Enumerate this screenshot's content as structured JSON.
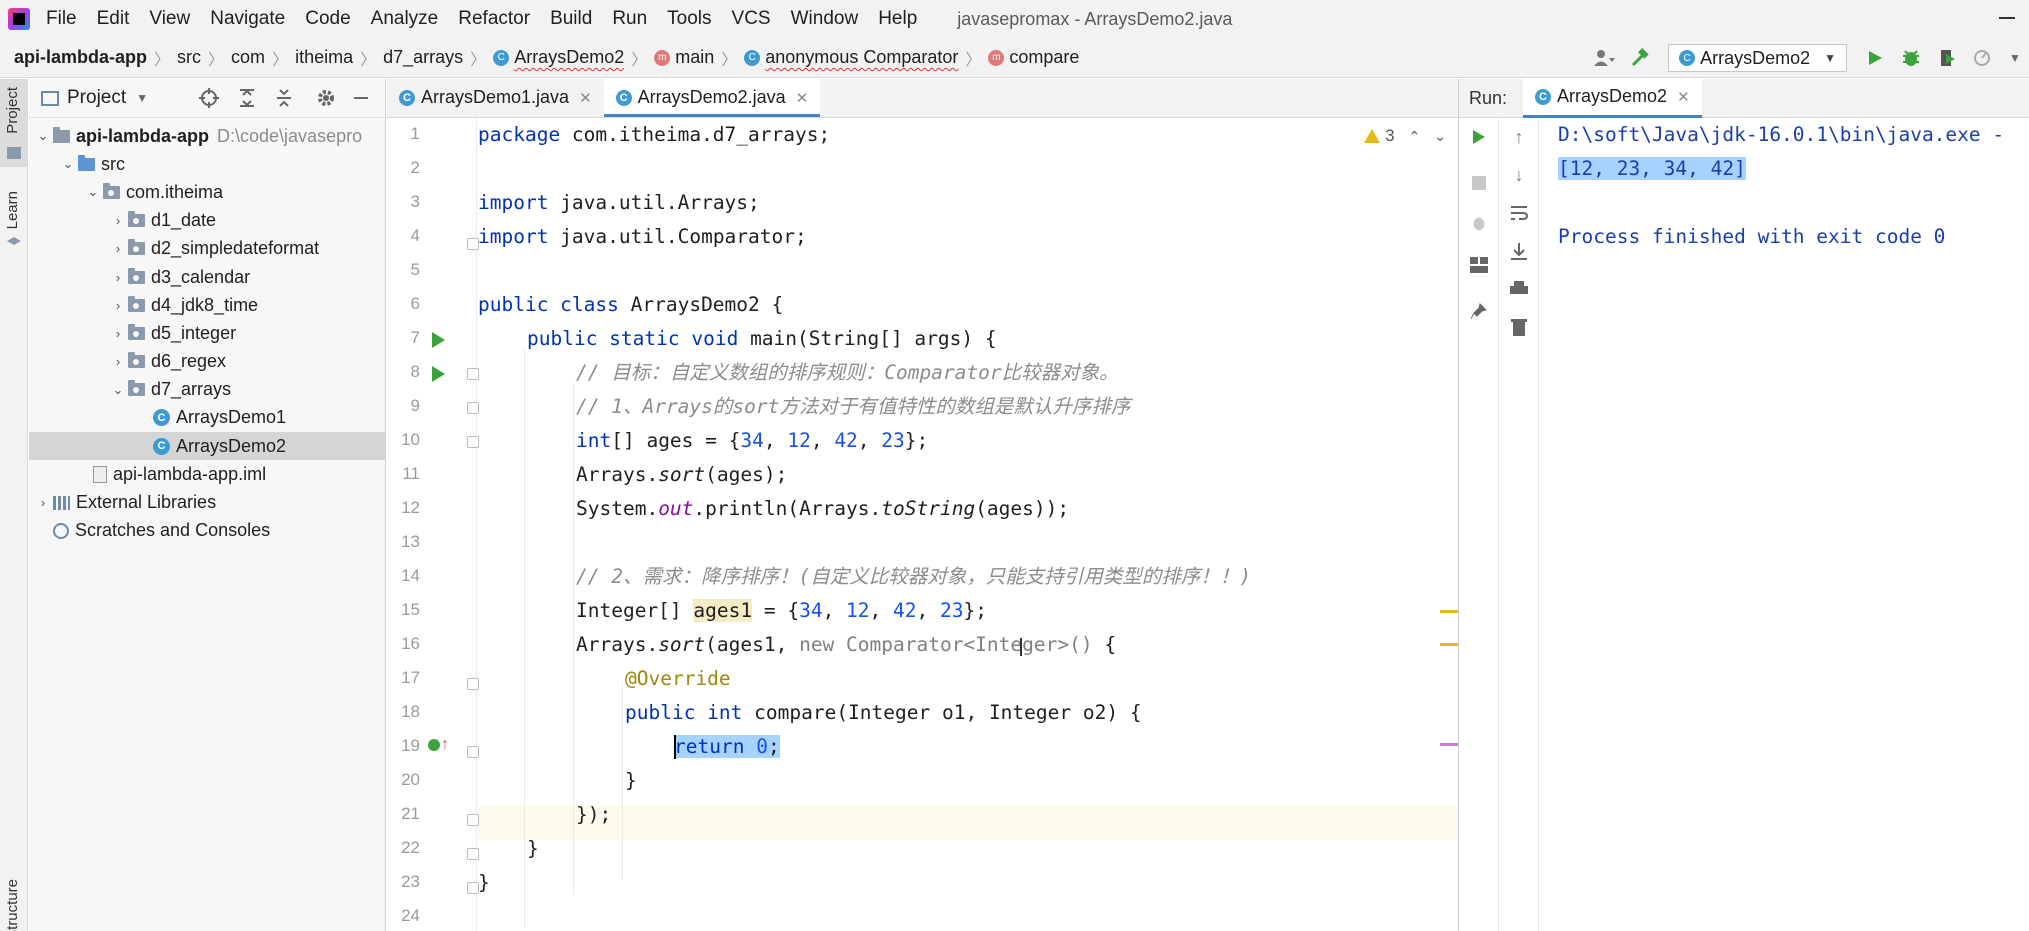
{
  "menubar": {
    "items": [
      "File",
      "Edit",
      "View",
      "Navigate",
      "Code",
      "Analyze",
      "Refactor",
      "Build",
      "Run",
      "Tools",
      "VCS",
      "Window",
      "Help"
    ],
    "window_title": "javasepromax - ArraysDemo2.java"
  },
  "breadcrumb": {
    "project": "api-lambda-app",
    "src": "src",
    "com": "com",
    "itheima": "itheima",
    "package": "d7_arrays",
    "class": "ArraysDemo2",
    "method": "main",
    "anonymous": "anonymous Comparator",
    "compare": "compare"
  },
  "toolbar": {
    "run_config": "ArraysDemo2"
  },
  "left_stripe": {
    "project": "Project",
    "learn": "Learn",
    "structure": "Structure"
  },
  "project_panel": {
    "title": "Project",
    "tree": {
      "root": "api-lambda-app",
      "root_path": "D:\\code\\javasepro",
      "src": "src",
      "package_root": "com.itheima",
      "packages": [
        "d1_date",
        "d2_simpledateformat",
        "d3_calendar",
        "d4_jdk8_time",
        "d5_integer",
        "d6_regex",
        "d7_arrays"
      ],
      "classes": [
        "ArraysDemo1",
        "ArraysDemo2"
      ],
      "iml": "api-lambda-app.iml",
      "external": "External Libraries",
      "scratches": "Scratches and Consoles"
    }
  },
  "editor": {
    "tabs": [
      "ArraysDemo1.java",
      "ArraysDemo2.java"
    ],
    "active_tab": "ArraysDemo2.java",
    "warning_count": "3",
    "line_numbers": [
      "1",
      "2",
      "3",
      "4",
      "5",
      "6",
      "7",
      "8",
      "9",
      "10",
      "11",
      "12",
      "13",
      "14",
      "15",
      "16",
      "17",
      "18",
      "19",
      "20",
      "21",
      "22",
      "23",
      "24"
    ],
    "code": {
      "l1_kw": "package",
      "l1_rest": " com.itheima.d7_arrays;",
      "l3_kw": "import",
      "l3_rest": " java.util.Arrays;",
      "l4_kw": "import",
      "l4_rest": " java.util.Comparator;",
      "l6_kw": "public class",
      "l6_rest": " ArraysDemo2 {",
      "l7_kw": "public static void",
      "l7_rest": " main(String[] args) {",
      "l8": "// 目标：自定义数组的排序规则：Comparator比较器对象。",
      "l9": "// 1、Arrays的sort方法对于有值特性的数组是默认升序排序",
      "l10_kw": "int",
      "l10_a": "[] ages = {",
      "l10_n1": "34",
      "l10_n2": "12",
      "l10_n3": "42",
      "l10_n4": "23",
      "l10_end": "};",
      "l11_a": "Arrays.",
      "l11_m": "sort",
      "l11_b": "(ages);",
      "l12_a": "System.",
      "l12_s": "out",
      "l12_b": ".println(Arrays.",
      "l12_m": "toString",
      "l12_c": "(ages));",
      "l14": "// 2、需求：降序排序！(自定义比较器对象，只能支持引用类型的排序！！)",
      "l15_a": "Integer[] ",
      "l15_var": "ages1",
      "l15_b": " = {",
      "l15_n1": "34",
      "l15_n2": "12",
      "l15_n3": "42",
      "l15_n4": "23",
      "l15_end": "};",
      "l16_a": "Arrays.",
      "l16_m": "sort",
      "l16_b": "(ages1, ",
      "l16_gray": "new Comparator<Integer>() ",
      "l16_c": "{",
      "l17": "@Override",
      "l18_kw": "public int",
      "l18_rest": " compare(Integer o1, Integer o2) {",
      "l19_kw": "return",
      "l19_num": "0",
      "l19_end": ";",
      "l20": "}",
      "l21": "});",
      "l22": "}",
      "l23": "}"
    }
  },
  "run_panel": {
    "label": "Run:",
    "tab": "ArraysDemo2",
    "console": {
      "cmd": "D:\\soft\\Java\\jdk-16.0.1\\bin\\java.exe -",
      "output": "[12, 23, 34, 42]",
      "exit": "Process finished with exit code 0"
    }
  },
  "colors": {
    "keyword": "#0033b3",
    "number": "#1750eb",
    "comment": "#8c8c8c",
    "static_field": "#871094",
    "annotation": "#9e880d",
    "console_text": "#1a3fad",
    "selection": "#a6d2ff",
    "run_green": "#3ca33c"
  }
}
